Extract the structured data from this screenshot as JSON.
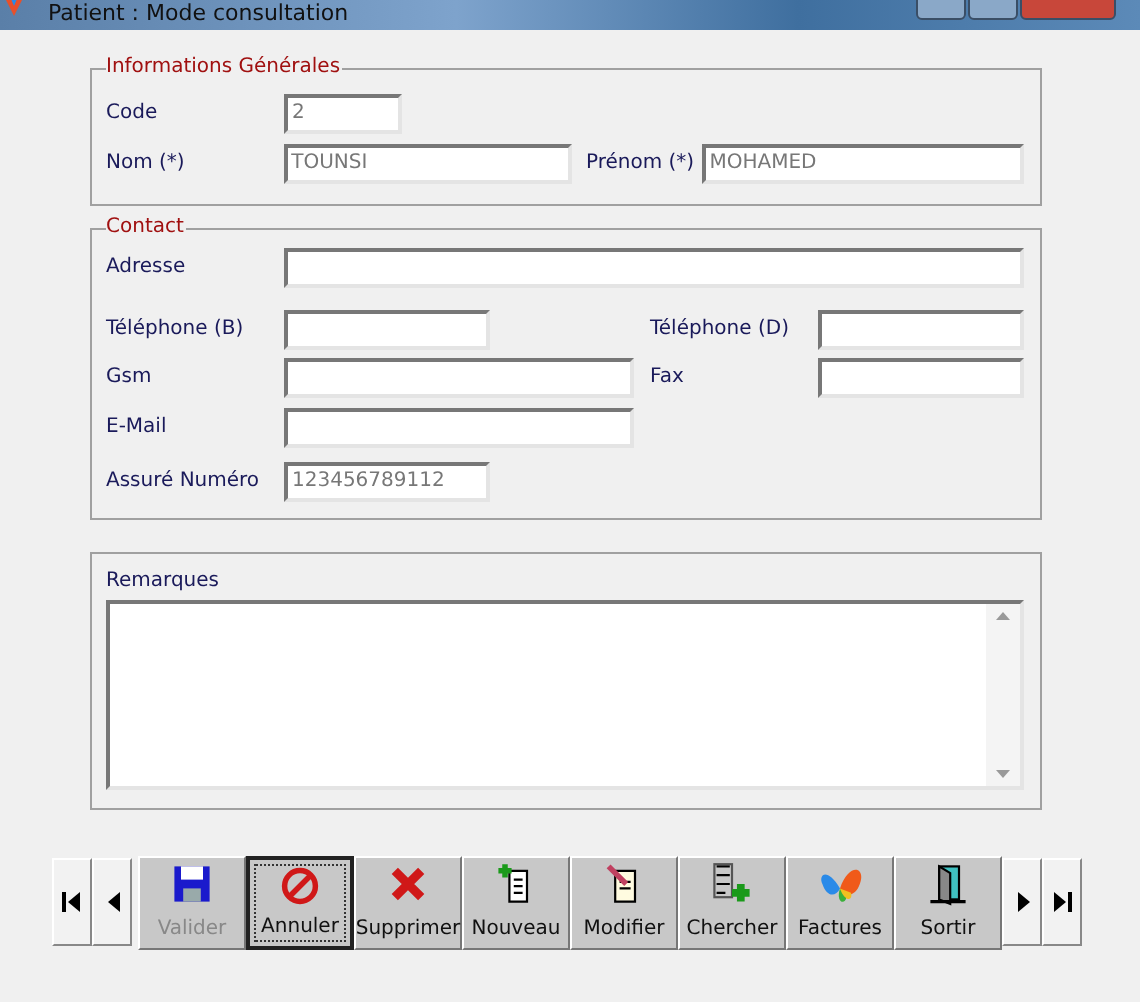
{
  "window": {
    "title": "Patient  : Mode consultation"
  },
  "general": {
    "title": "Informations Générales",
    "fields": [
      {
        "label": "Code",
        "value": "2"
      },
      {
        "label": "Nom (*)",
        "value": "TOUNSI"
      },
      {
        "label": "Prénom (*)",
        "value": "MOHAMED"
      }
    ]
  },
  "contact": {
    "title": "Contact",
    "fields": [
      {
        "label": "Adresse",
        "kind": "full"
      },
      {
        "label": "Téléphone (B)",
        "kind": "short"
      },
      {
        "label": "Téléphone (D)",
        "kind": "short"
      },
      {
        "label": "Gsm",
        "kind": "medium"
      },
      {
        "label": "Fax",
        "kind": "short"
      },
      {
        "label": "E-Mail",
        "kind": "medium"
      },
      {
        "label": "Assuré Numéro",
        "value": "123456789112",
        "kind": "short"
      }
    ]
  },
  "remarks": {
    "label": "Remarques"
  },
  "toolbar": {
    "nav_left": [
      {
        "kind": "first"
      },
      {
        "kind": "prev"
      }
    ],
    "buttons": [
      {
        "label": "Valider",
        "kind": "save",
        "disabled": true,
        "focused": false
      },
      {
        "label": "Annuler",
        "kind": "cancel",
        "disabled": false,
        "focused": true
      },
      {
        "label": "Supprimer",
        "kind": "delete",
        "disabled": false,
        "focused": false
      },
      {
        "label": "Nouveau",
        "kind": "new",
        "disabled": false,
        "focused": false
      },
      {
        "label": "Modifier",
        "kind": "edit",
        "disabled": false,
        "focused": false
      },
      {
        "label": "Chercher",
        "kind": "search",
        "disabled": false,
        "focused": false
      },
      {
        "label": "Factures",
        "kind": "invoices",
        "disabled": false,
        "focused": false
      },
      {
        "label": "Sortir",
        "kind": "exit",
        "disabled": false,
        "focused": false
      }
    ],
    "nav_right": [
      {
        "kind": "next"
      },
      {
        "kind": "last"
      }
    ]
  }
}
